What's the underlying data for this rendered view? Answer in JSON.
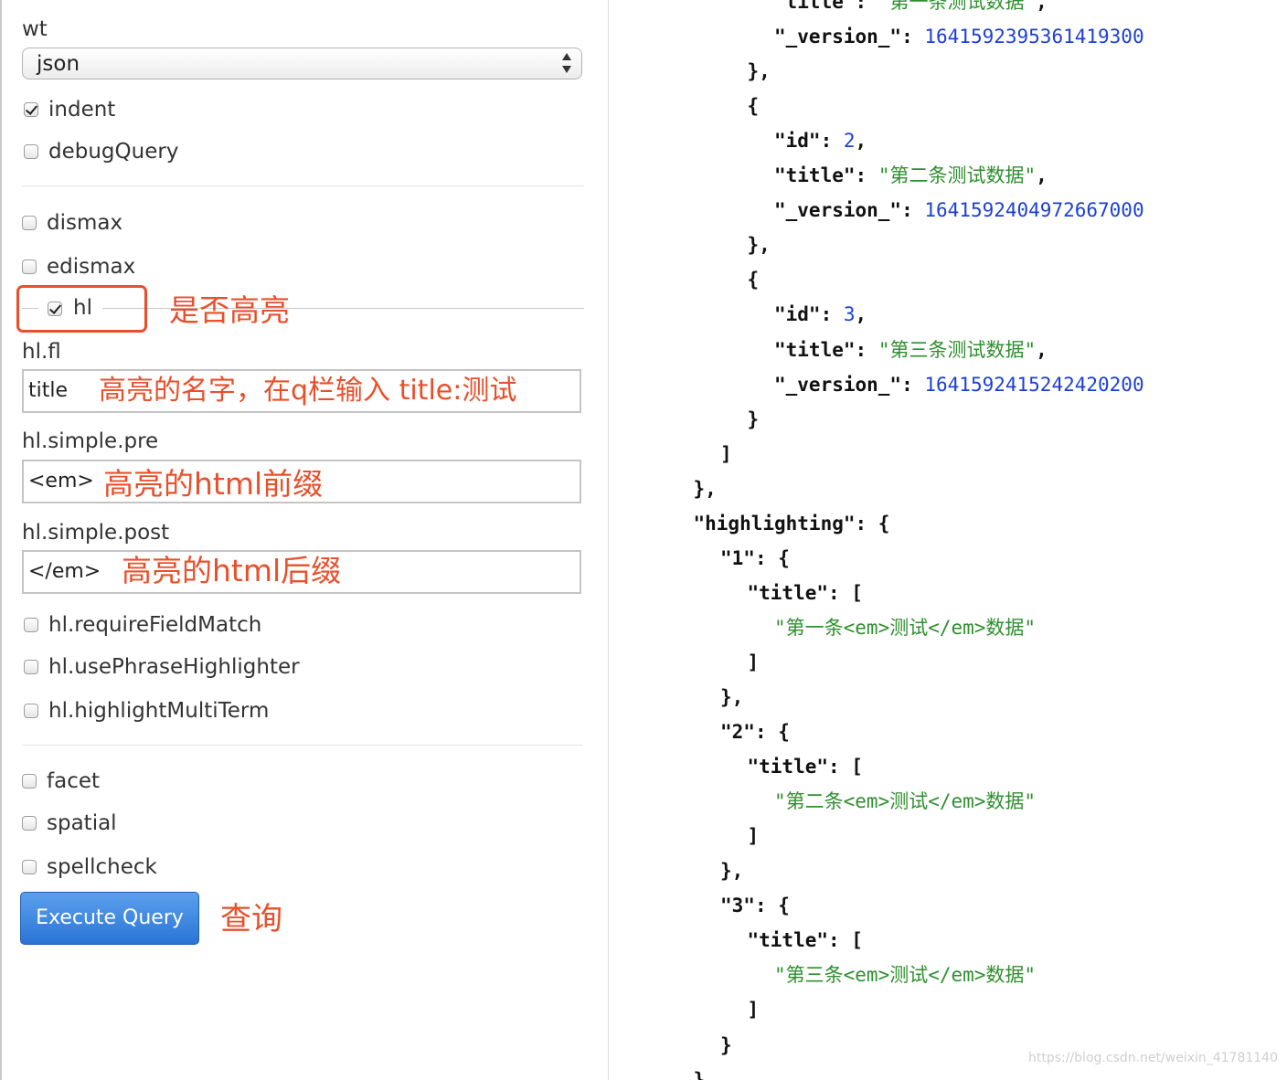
{
  "left": {
    "wt_label": "wt",
    "wt_value": "json",
    "checkboxes_top": [
      {
        "label": "indent",
        "checked": true
      },
      {
        "label": "debugQuery",
        "checked": false
      }
    ],
    "parsers": [
      {
        "label": "dismax",
        "checked": false
      },
      {
        "label": "edismax",
        "checked": false
      }
    ],
    "hl": {
      "label": "hl",
      "checked": true
    },
    "fields": [
      {
        "label": "hl.fl",
        "value": "title"
      },
      {
        "label": "hl.simple.pre",
        "value": "<em>"
      },
      {
        "label": "hl.simple.post",
        "value": "</em>"
      }
    ],
    "hl_options": [
      {
        "label": "hl.requireFieldMatch",
        "checked": false
      },
      {
        "label": "hl.usePhraseHighlighter",
        "checked": false
      },
      {
        "label": "hl.highlightMultiTerm",
        "checked": false
      }
    ],
    "features": [
      {
        "label": "facet",
        "checked": false
      },
      {
        "label": "spatial",
        "checked": false
      },
      {
        "label": "spellcheck",
        "checked": false
      }
    ],
    "execute_label": "Execute Query"
  },
  "annotations": {
    "hl": "是否高亮",
    "hl_fl": "高亮的名字，在q栏输入 title:测试",
    "pre": "高亮的html前缀",
    "post": "高亮的html后缀",
    "execute": "查询"
  },
  "json_lines": [
    {
      "indent": 6,
      "parts": [
        {
          "t": "k",
          "v": "\"title\""
        },
        {
          "t": "p",
          "v": ": "
        },
        {
          "t": "s",
          "v": "\"第一条测试数据\""
        },
        {
          "t": "p",
          "v": ","
        }
      ]
    },
    {
      "indent": 6,
      "parts": [
        {
          "t": "k",
          "v": "\"_version_\""
        },
        {
          "t": "p",
          "v": ": "
        },
        {
          "t": "n",
          "v": "1641592395361419300"
        }
      ]
    },
    {
      "indent": 5,
      "parts": [
        {
          "t": "p",
          "v": "},"
        }
      ]
    },
    {
      "indent": 5,
      "parts": [
        {
          "t": "p",
          "v": "{"
        }
      ]
    },
    {
      "indent": 6,
      "parts": [
        {
          "t": "k",
          "v": "\"id\""
        },
        {
          "t": "p",
          "v": ": "
        },
        {
          "t": "n",
          "v": "2"
        },
        {
          "t": "p",
          "v": ","
        }
      ]
    },
    {
      "indent": 6,
      "parts": [
        {
          "t": "k",
          "v": "\"title\""
        },
        {
          "t": "p",
          "v": ": "
        },
        {
          "t": "s",
          "v": "\"第二条测试数据\""
        },
        {
          "t": "p",
          "v": ","
        }
      ]
    },
    {
      "indent": 6,
      "parts": [
        {
          "t": "k",
          "v": "\"_version_\""
        },
        {
          "t": "p",
          "v": ": "
        },
        {
          "t": "n",
          "v": "1641592404972667000"
        }
      ]
    },
    {
      "indent": 5,
      "parts": [
        {
          "t": "p",
          "v": "},"
        }
      ]
    },
    {
      "indent": 5,
      "parts": [
        {
          "t": "p",
          "v": "{"
        }
      ]
    },
    {
      "indent": 6,
      "parts": [
        {
          "t": "k",
          "v": "\"id\""
        },
        {
          "t": "p",
          "v": ": "
        },
        {
          "t": "n",
          "v": "3"
        },
        {
          "t": "p",
          "v": ","
        }
      ]
    },
    {
      "indent": 6,
      "parts": [
        {
          "t": "k",
          "v": "\"title\""
        },
        {
          "t": "p",
          "v": ": "
        },
        {
          "t": "s",
          "v": "\"第三条测试数据\""
        },
        {
          "t": "p",
          "v": ","
        }
      ]
    },
    {
      "indent": 6,
      "parts": [
        {
          "t": "k",
          "v": "\"_version_\""
        },
        {
          "t": "p",
          "v": ": "
        },
        {
          "t": "n",
          "v": "1641592415242420200"
        }
      ]
    },
    {
      "indent": 5,
      "parts": [
        {
          "t": "p",
          "v": "}"
        }
      ]
    },
    {
      "indent": 4,
      "parts": [
        {
          "t": "p",
          "v": "]"
        }
      ]
    },
    {
      "indent": 3,
      "parts": [
        {
          "t": "p",
          "v": "},"
        }
      ]
    },
    {
      "indent": 3,
      "parts": [
        {
          "t": "k",
          "v": "\"highlighting\""
        },
        {
          "t": "p",
          "v": ": {"
        }
      ]
    },
    {
      "indent": 4,
      "parts": [
        {
          "t": "k",
          "v": "\"1\""
        },
        {
          "t": "p",
          "v": ": {"
        }
      ]
    },
    {
      "indent": 5,
      "parts": [
        {
          "t": "k",
          "v": "\"title\""
        },
        {
          "t": "p",
          "v": ": ["
        }
      ]
    },
    {
      "indent": 6,
      "parts": [
        {
          "t": "s",
          "v": "\"第一条<em>测试</em>数据\""
        }
      ]
    },
    {
      "indent": 5,
      "parts": [
        {
          "t": "p",
          "v": "]"
        }
      ]
    },
    {
      "indent": 4,
      "parts": [
        {
          "t": "p",
          "v": "},"
        }
      ]
    },
    {
      "indent": 4,
      "parts": [
        {
          "t": "k",
          "v": "\"2\""
        },
        {
          "t": "p",
          "v": ": {"
        }
      ]
    },
    {
      "indent": 5,
      "parts": [
        {
          "t": "k",
          "v": "\"title\""
        },
        {
          "t": "p",
          "v": ": ["
        }
      ]
    },
    {
      "indent": 6,
      "parts": [
        {
          "t": "s",
          "v": "\"第二条<em>测试</em>数据\""
        }
      ]
    },
    {
      "indent": 5,
      "parts": [
        {
          "t": "p",
          "v": "]"
        }
      ]
    },
    {
      "indent": 4,
      "parts": [
        {
          "t": "p",
          "v": "},"
        }
      ]
    },
    {
      "indent": 4,
      "parts": [
        {
          "t": "k",
          "v": "\"3\""
        },
        {
          "t": "p",
          "v": ": {"
        }
      ]
    },
    {
      "indent": 5,
      "parts": [
        {
          "t": "k",
          "v": "\"title\""
        },
        {
          "t": "p",
          "v": ": ["
        }
      ]
    },
    {
      "indent": 6,
      "parts": [
        {
          "t": "s",
          "v": "\"第三条<em>测试</em>数据\""
        }
      ]
    },
    {
      "indent": 5,
      "parts": [
        {
          "t": "p",
          "v": "]"
        }
      ]
    },
    {
      "indent": 4,
      "parts": [
        {
          "t": "p",
          "v": "}"
        }
      ]
    },
    {
      "indent": 3,
      "parts": [
        {
          "t": "p",
          "v": "}"
        }
      ]
    }
  ],
  "watermark": "https://blog.csdn.net/weixin_41781140"
}
